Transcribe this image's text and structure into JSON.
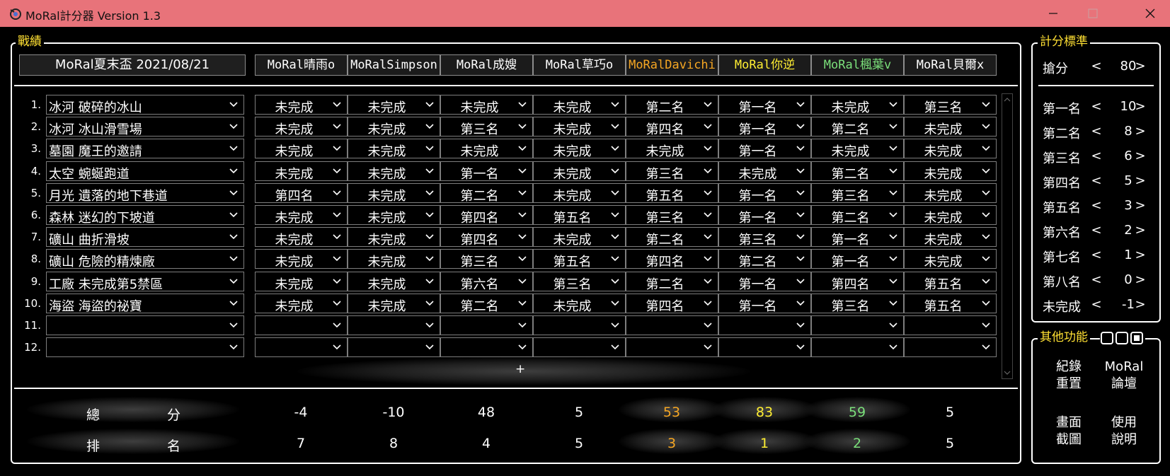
{
  "window": {
    "title": "MoRal計分器 Version 1.3"
  },
  "record": {
    "legend": "戰績",
    "event_name": "MoRal夏末盃 2021/08/21",
    "players": [
      {
        "name": "MoRal晴雨o",
        "color": "#ffffff"
      },
      {
        "name": "MoRalSimpson",
        "color": "#ffffff"
      },
      {
        "name": "MoRal成嫂",
        "color": "#ffffff"
      },
      {
        "name": "MoRal草巧o",
        "color": "#ffffff"
      },
      {
        "name": "MoRalDavichi",
        "color": "#f5a623"
      },
      {
        "name": "MoRal你逆",
        "color": "#ffee33"
      },
      {
        "name": "MoRal楓葉v",
        "color": "#7be07b"
      },
      {
        "name": "MoRal貝爾x",
        "color": "#ffffff"
      }
    ],
    "rows": [
      {
        "num": "1.",
        "track": "冰河 破碎的冰山",
        "results": [
          "未完成",
          "未完成",
          "未完成",
          "未完成",
          "第二名",
          "第一名",
          "未完成",
          "第三名"
        ]
      },
      {
        "num": "2.",
        "track": "冰河 冰山滑雪場",
        "results": [
          "未完成",
          "未完成",
          "第三名",
          "未完成",
          "第四名",
          "第一名",
          "第二名",
          "未完成"
        ]
      },
      {
        "num": "3.",
        "track": "墓園 魔王的邀請",
        "results": [
          "未完成",
          "未完成",
          "未完成",
          "未完成",
          "未完成",
          "第一名",
          "未完成",
          "未完成"
        ]
      },
      {
        "num": "4.",
        "track": "太空 蜿蜒跑道",
        "results": [
          "未完成",
          "未完成",
          "第一名",
          "未完成",
          "第三名",
          "未完成",
          "第二名",
          "未完成"
        ]
      },
      {
        "num": "5.",
        "track": "月光 遺落的地下巷道",
        "results": [
          "第四名",
          "未完成",
          "第二名",
          "未完成",
          "第五名",
          "第一名",
          "第三名",
          "未完成"
        ]
      },
      {
        "num": "6.",
        "track": "森林 迷幻的下坡道",
        "results": [
          "未完成",
          "未完成",
          "第四名",
          "第五名",
          "第三名",
          "第一名",
          "第二名",
          "未完成"
        ]
      },
      {
        "num": "7.",
        "track": "礦山 曲折滑坡",
        "results": [
          "未完成",
          "未完成",
          "第四名",
          "未完成",
          "第二名",
          "第三名",
          "第一名",
          "未完成"
        ]
      },
      {
        "num": "8.",
        "track": "礦山 危險的精煉廠",
        "results": [
          "未完成",
          "未完成",
          "第三名",
          "第五名",
          "第四名",
          "第二名",
          "第一名",
          "未完成"
        ]
      },
      {
        "num": "9.",
        "track": "工廠 未完成第5禁區",
        "results": [
          "未完成",
          "未完成",
          "第六名",
          "第三名",
          "第二名",
          "第一名",
          "第四名",
          "第五名"
        ]
      },
      {
        "num": "10.",
        "track": "海盜 海盜的祕寶",
        "results": [
          "未完成",
          "未完成",
          "第二名",
          "未完成",
          "第四名",
          "第一名",
          "第三名",
          "第五名"
        ]
      },
      {
        "num": "11.",
        "track": "",
        "results": [
          "",
          "",
          "",
          "",
          "",
          "",
          "",
          ""
        ]
      },
      {
        "num": "12.",
        "track": "",
        "results": [
          "",
          "",
          "",
          "",
          "",
          "",
          "",
          ""
        ]
      }
    ],
    "add_row_label": "+",
    "total_label": [
      "總",
      "分"
    ],
    "totals": [
      "-4",
      "-10",
      "48",
      "5",
      "53",
      "83",
      "59",
      "5"
    ],
    "rank_label": [
      "排",
      "名"
    ],
    "ranks": [
      "7",
      "8",
      "4",
      "5",
      "3",
      "1",
      "2",
      "5"
    ]
  },
  "scoring": {
    "legend": "計分標準",
    "bonus": {
      "label": "搶分",
      "value": "80"
    },
    "items": [
      {
        "label": "第一名",
        "value": "10"
      },
      {
        "label": "第二名",
        "value": "8"
      },
      {
        "label": "第三名",
        "value": "6"
      },
      {
        "label": "第四名",
        "value": "5"
      },
      {
        "label": "第五名",
        "value": "3"
      },
      {
        "label": "第六名",
        "value": "2"
      },
      {
        "label": "第七名",
        "value": "1"
      },
      {
        "label": "第八名",
        "value": "0"
      },
      {
        "label": "未完成",
        "value": "-1"
      }
    ],
    "left_arrow": "<",
    "right_arrow": ">"
  },
  "other": {
    "legend": "其他功能",
    "buttons": [
      {
        "line1": "紀錄",
        "line2": "重置"
      },
      {
        "line1": "MoRal",
        "line2": "論壇"
      },
      {
        "line1": "畫面",
        "line2": "截圖"
      },
      {
        "line1": "使用",
        "line2": "說明"
      }
    ]
  },
  "colors": {
    "titlebar": "#e8737a",
    "legend": "#ffe033"
  }
}
